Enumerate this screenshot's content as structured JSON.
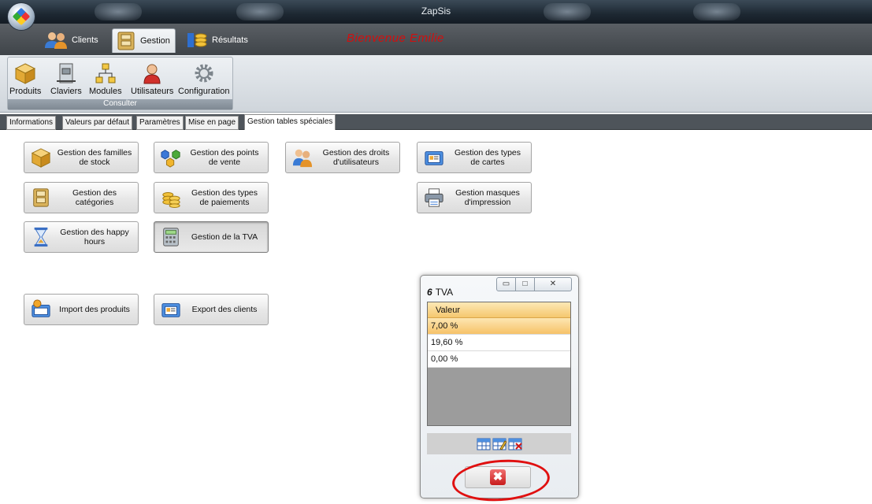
{
  "window": {
    "title": "ZapSis"
  },
  "ribbon_tabs": [
    {
      "label": "Clients",
      "icon": "users-icon"
    },
    {
      "label": "Gestion",
      "icon": "folder-icon",
      "active": true
    },
    {
      "label": "Résultats",
      "icon": "coins-chart-icon"
    }
  ],
  "welcome": "Bienvenue Emilie",
  "ribbon_group": {
    "label": "Consulter",
    "items": [
      {
        "label": "Produits",
        "icon": "box-icon"
      },
      {
        "label": "Claviers",
        "icon": "keyboard-icon"
      },
      {
        "label": "Modules",
        "icon": "hierarchy-icon"
      },
      {
        "label": "Utilisateurs",
        "icon": "user-icon"
      },
      {
        "label": "Configuration",
        "icon": "gear-icon"
      }
    ]
  },
  "page_tabs": [
    {
      "label": "Informations"
    },
    {
      "label": "Valeurs par défaut"
    },
    {
      "label": "Paramètres"
    },
    {
      "label": "Mise en page"
    },
    {
      "label": "Gestion tables spéciales",
      "active": true
    }
  ],
  "buttons": {
    "familles": "Gestion des familles de stock",
    "points_vente": "Gestion des points de vente",
    "droits": "Gestion des droits d'utilisateurs",
    "types_cartes": "Gestion des types de cartes",
    "categories": "Gestion des catégories",
    "types_paiements": "Gestion des types de paiements",
    "masques": "Gestion masques d'impression",
    "happy_hours": "Gestion des happy hours",
    "tva": "Gestion de la TVA",
    "import_produits": "Import des produits",
    "export_clients": "Export des clients"
  },
  "dialog": {
    "title_prefix": "6",
    "title": "TVA",
    "column_header": "Valeur",
    "rows": [
      "7,00 %",
      "19,60 %",
      "0,00 %"
    ],
    "selected_index": 0
  },
  "colors": {
    "welcome": "#d10f0f",
    "highlight_ring": "#e01010",
    "selected_row": "#f6c268"
  }
}
